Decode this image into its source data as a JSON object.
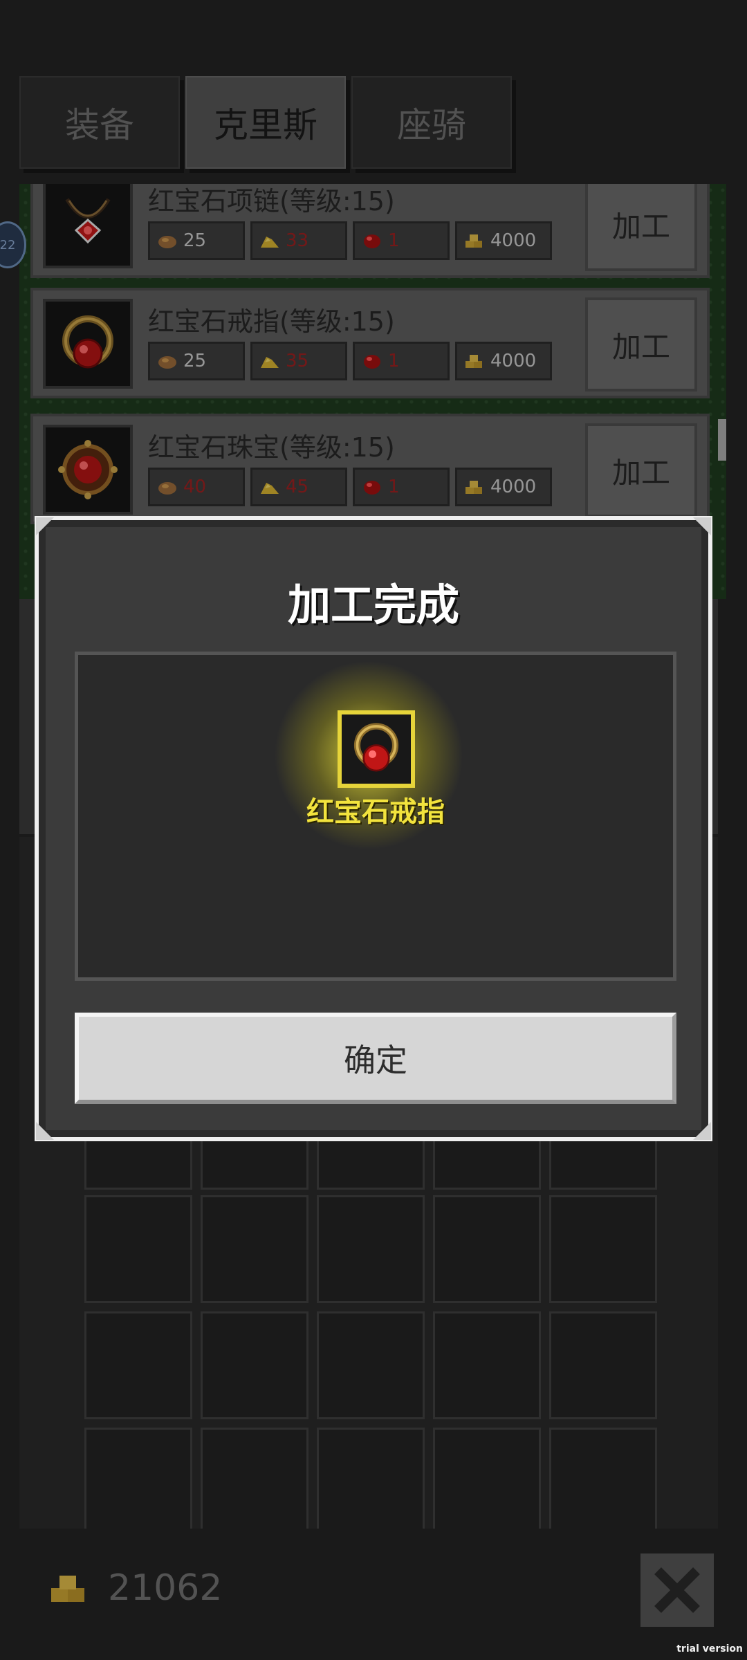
{
  "tabs": [
    {
      "label": "装备",
      "active": false
    },
    {
      "label": "克里斯",
      "active": true
    },
    {
      "label": "座骑",
      "active": false
    }
  ],
  "badge": "22",
  "recipes": [
    {
      "name": "红宝石项链(等级:15)",
      "icon": "ruby-necklace-icon",
      "costs": [
        {
          "resource": "ore",
          "value": "25",
          "sufficient": true
        },
        {
          "resource": "gold-nugget",
          "value": "33",
          "sufficient": false
        },
        {
          "resource": "ruby",
          "value": "1",
          "sufficient": false
        },
        {
          "resource": "gold-bars",
          "value": "4000",
          "sufficient": true
        }
      ],
      "button": "加工"
    },
    {
      "name": "红宝石戒指(等级:15)",
      "icon": "ruby-ring-icon",
      "costs": [
        {
          "resource": "ore",
          "value": "25",
          "sufficient": true
        },
        {
          "resource": "gold-nugget",
          "value": "35",
          "sufficient": false
        },
        {
          "resource": "ruby",
          "value": "1",
          "sufficient": false
        },
        {
          "resource": "gold-bars",
          "value": "4000",
          "sufficient": true
        }
      ],
      "button": "加工"
    },
    {
      "name": "红宝石珠宝(等级:15)",
      "icon": "ruby-jewel-icon",
      "costs": [
        {
          "resource": "ore",
          "value": "40",
          "sufficient": false
        },
        {
          "resource": "gold-nugget",
          "value": "45",
          "sufficient": false
        },
        {
          "resource": "ruby",
          "value": "1",
          "sufficient": false
        },
        {
          "resource": "gold-bars",
          "value": "4000",
          "sufficient": true
        }
      ],
      "button": "加工"
    }
  ],
  "modal": {
    "title": "加工完成",
    "reward_name": "红宝石戒指",
    "reward_icon": "ruby-ring-icon",
    "confirm": "确定"
  },
  "footer": {
    "gold": "21062",
    "trial": "trial version"
  },
  "colors": {
    "accent_yellow": "#f2e33d",
    "insufficient_red": "#9a2020"
  }
}
